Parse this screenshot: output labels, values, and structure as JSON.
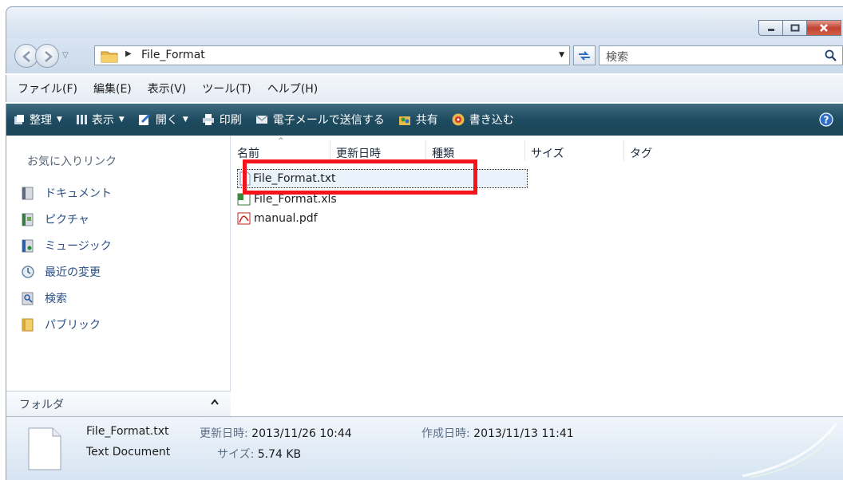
{
  "window": {
    "caption_buttons": [
      "minimize",
      "maximize",
      "close"
    ]
  },
  "address": {
    "path": "File_Format",
    "search_placeholder": "検索"
  },
  "menu": [
    "ファイル(F)",
    "編集(E)",
    "表示(V)",
    "ツール(T)",
    "ヘルプ(H)"
  ],
  "commands": [
    {
      "label": "整理",
      "icon": "organize-icon",
      "dropdown": true
    },
    {
      "label": "表示",
      "icon": "views-icon",
      "dropdown": true
    },
    {
      "label": "開く",
      "icon": "open-icon",
      "dropdown": true
    },
    {
      "label": "印刷",
      "icon": "print-icon",
      "dropdown": false
    },
    {
      "label": "電子メールで送信する",
      "icon": "email-icon",
      "dropdown": false
    },
    {
      "label": "共有",
      "icon": "share-icon",
      "dropdown": false
    },
    {
      "label": "書き込む",
      "icon": "burn-icon",
      "dropdown": false
    }
  ],
  "sidebar": {
    "header": "お気に入りリンク",
    "items": [
      {
        "label": "ドキュメント",
        "icon": "documents-icon"
      },
      {
        "label": "ピクチャ",
        "icon": "pictures-icon"
      },
      {
        "label": "ミュージック",
        "icon": "music-icon"
      },
      {
        "label": "最近の変更",
        "icon": "recent-changes-icon"
      },
      {
        "label": "検索",
        "icon": "searches-icon"
      },
      {
        "label": "パブリック",
        "icon": "public-folder-icon"
      }
    ],
    "folders_label": "フォルダ",
    "folders_toggle": "^"
  },
  "columns": [
    "名前",
    "更新日時",
    "種類",
    "サイズ",
    "タグ"
  ],
  "files": [
    {
      "name": "File_Format.txt",
      "icon": "text-file-icon",
      "selected": true
    },
    {
      "name": "File_Format.xls",
      "icon": "excel-file-icon",
      "selected": false
    },
    {
      "name": "manual.pdf",
      "icon": "pdf-file-icon",
      "selected": false
    }
  ],
  "details": {
    "filename": "File_Format.txt",
    "type": "Text Document",
    "modified_label": "更新日時:",
    "modified_value": "2013/11/26 10:44",
    "created_label": "作成日時:",
    "created_value": "2013/11/13 11:41",
    "size_label": "サイズ:",
    "size_value": "5.74 KB"
  },
  "colors": {
    "command_bar": "#1e4b60",
    "highlight_box": "#f5141c",
    "link_text": "#2a4f84"
  }
}
